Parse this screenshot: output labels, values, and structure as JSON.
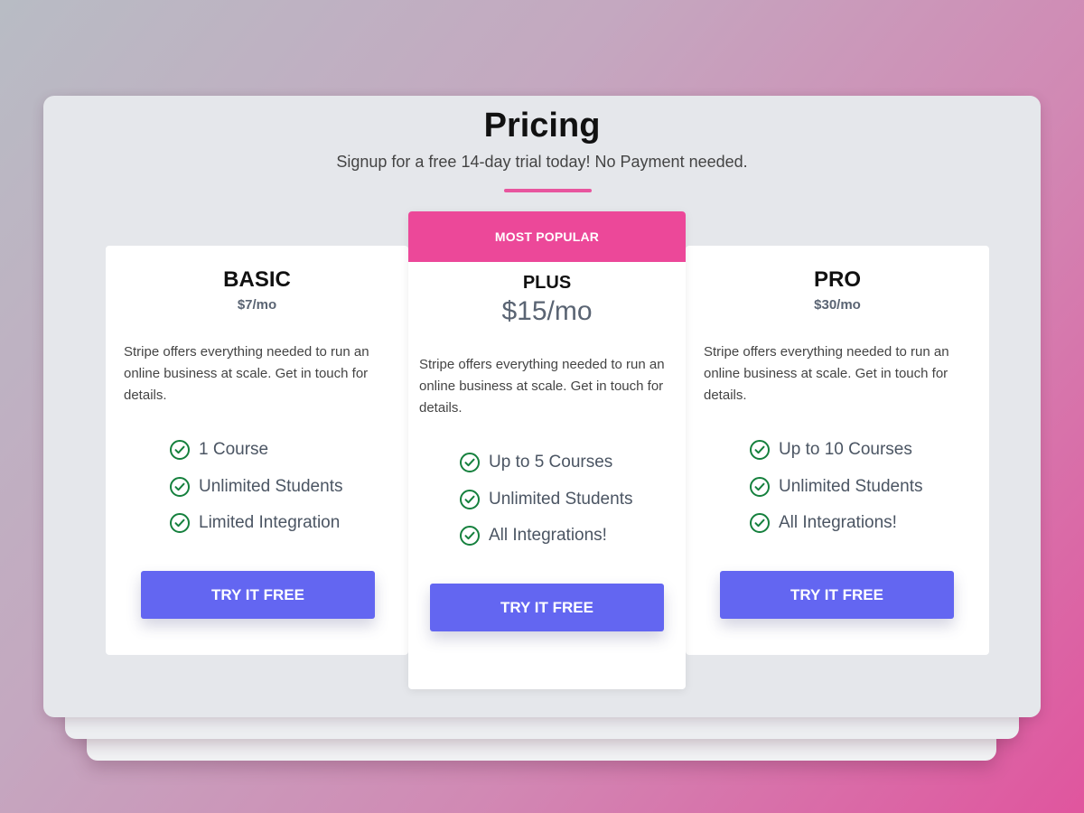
{
  "header": {
    "title": "Pricing",
    "subtitle": "Signup for a free 14-day trial today! No Payment needed."
  },
  "colors": {
    "accent": "#ec4899",
    "button": "#6366f1",
    "check": "#15803d"
  },
  "plans": [
    {
      "name": "BASIC",
      "price": "$7/mo",
      "description": "Stripe offers everything needed to run an online business at scale. Get in touch for details.",
      "features": [
        "1 Course",
        "Unlimited Students",
        "Limited Integration"
      ],
      "cta": "TRY IT FREE",
      "icon": "check-circle-icon"
    },
    {
      "badge": "MOST POPULAR",
      "name": "PLUS",
      "price": "$15/mo",
      "description": "Stripe offers everything needed to run an online business at scale. Get in touch for details.",
      "features": [
        "Up to 5 Courses",
        "Unlimited Students",
        "All Integrations!"
      ],
      "cta": "TRY IT FREE",
      "icon": "check-circle-icon"
    },
    {
      "name": "PRO",
      "price": "$30/mo",
      "description": "Stripe offers everything needed to run an online business at scale. Get in touch for details.",
      "features": [
        "Up to 10 Courses",
        "Unlimited Students",
        "All Integrations!"
      ],
      "cta": "TRY IT FREE",
      "icon": "check-circle-icon"
    }
  ]
}
